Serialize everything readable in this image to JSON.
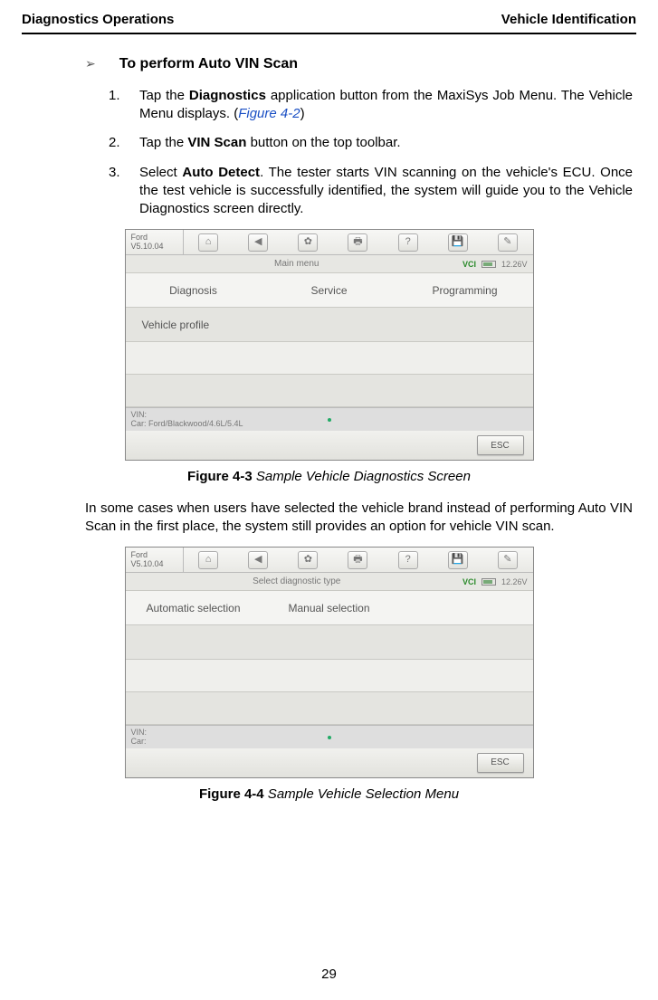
{
  "header": {
    "left": "Diagnostics Operations",
    "right": "Vehicle Identification"
  },
  "section": {
    "title": "To perform Auto VIN Scan"
  },
  "steps": [
    {
      "num": "1.",
      "pre": "Tap the ",
      "bold": "Diagnostics",
      "post": " application button from the MaxiSys Job Menu. The Vehicle Menu displays. (",
      "ref": "Figure 4-2",
      "tail": ")"
    },
    {
      "num": "2.",
      "pre": "Tap the ",
      "bold": "VIN Scan",
      "post": " button on the top toolbar."
    },
    {
      "num": "3.",
      "pre": "Select ",
      "bold": "Auto Detect",
      "post": ". The tester starts VIN scanning on the vehicle's ECU. Once the test vehicle is successfully identified, the system will guide you to the Vehicle Diagnostics screen directly."
    }
  ],
  "fig3": {
    "caption_bold": "Figure 4-3",
    "caption_ital": " Sample Vehicle Diagnostics Screen",
    "brand": "Ford",
    "version": "V5.10.04",
    "subtitle": "Main menu",
    "vci": "VCI",
    "batt": "12.26V",
    "menu": {
      "a": "Diagnosis",
      "b": "Service",
      "c": "Programming",
      "d": "Vehicle profile"
    },
    "vin_label": "VIN:",
    "vin_car": "Car: Ford/Blackwood/4.6L/5.4L",
    "esc": "ESC",
    "icons": {
      "home": "⌂",
      "back": "◀",
      "settings": "✿",
      "print": "🖶",
      "help": "?",
      "save": "💾",
      "edit": "✎"
    }
  },
  "inter": "In some cases when users have selected the vehicle brand instead of performing Auto VIN Scan in the first place, the system still provides an option for vehicle VIN scan.",
  "fig4": {
    "caption_bold": "Figure 4-4",
    "caption_ital": " Sample Vehicle Selection Menu",
    "brand": "Ford",
    "version": "V5.10.04",
    "subtitle": "Select diagnostic type",
    "vci": "VCI",
    "batt": "12.26V",
    "menu": {
      "a": "Automatic selection",
      "b": "Manual selection"
    },
    "vin_label": "VIN:",
    "vin_car": "Car:",
    "esc": "ESC"
  },
  "page_number": "29"
}
